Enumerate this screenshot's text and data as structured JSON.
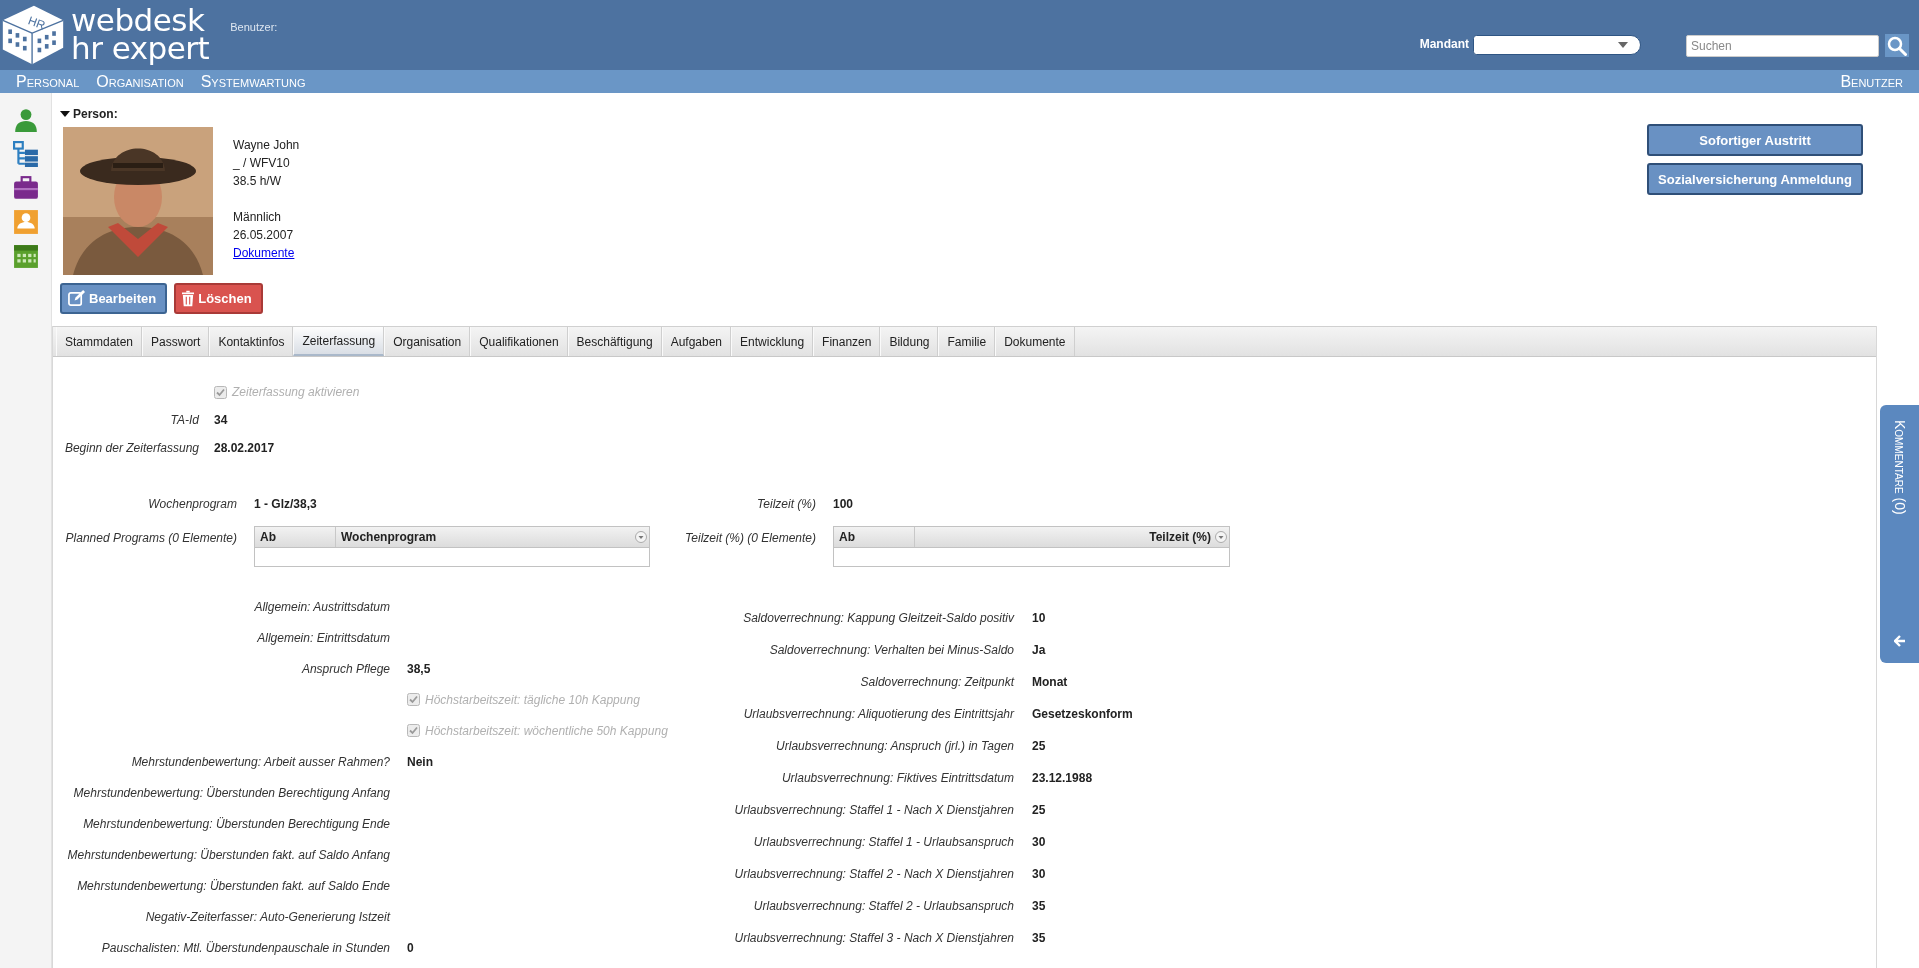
{
  "header": {
    "logo": {
      "badge": "HR",
      "line1": "webdesk",
      "line2": "hr expert"
    },
    "user_label": "Benutzer:",
    "mandant": {
      "label": "Mandant"
    },
    "search": {
      "placeholder": "Suchen"
    }
  },
  "nav": {
    "items": [
      "Personal",
      "Organisation",
      "Systemwartung"
    ],
    "right": "Benutzer"
  },
  "person": {
    "heading": "Person:",
    "expanded": true,
    "photo": {
      "kind": "picture"
    },
    "info": [
      [
        "Wayne John",
        "_ / WFV10",
        "38.5 h/W"
      ],
      [
        "Männlich",
        "26.05.2007"
      ]
    ],
    "link": "Dokumente",
    "actions": [
      {
        "label": "Bearbeiten",
        "kind": "edit"
      },
      {
        "label": "Löschen",
        "kind": "delete"
      }
    ],
    "side_actions": [
      "Sofortiger Austritt",
      "Sozialversicherung Anmeldung"
    ]
  },
  "tabs": [
    {
      "label": "Stammdaten",
      "selected": false
    },
    {
      "label": "Passwort",
      "selected": false
    },
    {
      "label": "Kontaktinfos",
      "selected": false
    },
    {
      "label": "Zeiterfassung",
      "selected": true
    },
    {
      "label": "Organisation",
      "selected": false
    },
    {
      "label": "Qualifikationen",
      "selected": false
    },
    {
      "label": "Beschäftigung",
      "selected": false
    },
    {
      "label": "Aufgaben",
      "selected": false
    },
    {
      "label": "Entwicklung",
      "selected": false
    },
    {
      "label": "Finanzen",
      "selected": false
    },
    {
      "label": "Bildung",
      "selected": false
    },
    {
      "label": "Familie",
      "selected": false
    },
    {
      "label": "Dokumente",
      "selected": false
    }
  ],
  "form": {
    "activate": {
      "label": "Zeiterfassung aktivieren",
      "checked": true,
      "disabled": true
    },
    "fields": [
      {
        "label": "TA-Id",
        "value": "34"
      },
      {
        "label": "Beginn der Zeiterfassung",
        "value": "28.02.2017"
      }
    ]
  },
  "programs": [
    {
      "label": "Wochenprogram",
      "value": "1 - Glz/38,3",
      "grid": {
        "label": "Planned Programs (0 Elemente)",
        "columns": [
          {
            "label": "Ab",
            "align_right": false
          },
          {
            "label": "Wochenprogram",
            "align_right": false
          }
        ]
      }
    },
    {
      "label": "Teilzeit (%)",
      "value": "100",
      "grid": {
        "label": "Teilzeit (%) (0 Elemente)",
        "columns": [
          {
            "label": "Ab",
            "align_right": false
          },
          {
            "label": "Teilzeit (%)",
            "align_right": true
          }
        ]
      }
    }
  ],
  "settings_left": [
    {
      "kind": "field",
      "label": "Allgemein: Austrittsdatum"
    },
    {
      "kind": "field",
      "label": "Allgemein: Eintrittsdatum"
    },
    {
      "kind": "field",
      "label": "Anspruch Pflege",
      "value": "38,5"
    },
    {
      "kind": "checkbox",
      "label": "Höchstarbeitszeit: tägliche 10h Kappung",
      "checked": true,
      "disabled": true
    },
    {
      "kind": "checkbox",
      "label": "Höchstarbeitszeit: wöchentliche 50h Kappung",
      "checked": true,
      "disabled": true
    },
    {
      "kind": "field",
      "label": "Mehrstundenbewertung: Arbeit ausser Rahmen?",
      "value": "Nein"
    },
    {
      "kind": "field",
      "label": "Mehrstundenbewertung: Überstunden Berechtigung Anfang"
    },
    {
      "kind": "field",
      "label": "Mehrstundenbewertung: Überstunden Berechtigung Ende"
    },
    {
      "kind": "field",
      "label": "Mehrstundenbewertung: Überstunden fakt. auf Saldo Anfang"
    },
    {
      "kind": "field",
      "label": "Mehrstundenbewertung: Überstunden fakt. auf Saldo Ende"
    },
    {
      "kind": "field",
      "label": "Negativ-Zeiterfasser: Auto-Generierung Istzeit"
    },
    {
      "kind": "field",
      "label": "Pauschalisten: Mtl. Überstundenpauschale in Stunden",
      "value": "0"
    }
  ],
  "settings_right": [
    {
      "kind": "field",
      "label": "Saldoverrechnung: Kappung Gleitzeit-Saldo positiv",
      "value": "10"
    },
    {
      "kind": "field",
      "label": "Saldoverrechnung: Verhalten bei Minus-Saldo",
      "value": "Ja"
    },
    {
      "kind": "field",
      "label": "Saldoverrechnung: Zeitpunkt",
      "value": "Monat"
    },
    {
      "kind": "field",
      "label": "Urlaubsverrechnung: Aliquotierung des Eintrittsjahr",
      "value": "Gesetzeskonform"
    },
    {
      "kind": "field",
      "label": "Urlaubsverrechnung: Anspruch (jrl.) in Tagen",
      "value": "25"
    },
    {
      "kind": "field",
      "label": "Urlaubsverrechnung: Fiktives Eintrittsdatum",
      "value": "23.12.1988"
    },
    {
      "kind": "field",
      "label": "Urlaubsverrechnung: Staffel 1 - Nach X Dienstjahren",
      "value": "25"
    },
    {
      "kind": "field",
      "label": "Urlaubsverrechnung: Staffel 1 - Urlaubsanspruch",
      "value": "30"
    },
    {
      "kind": "field",
      "label": "Urlaubsverrechnung: Staffel 2 - Nach X Dienstjahren",
      "value": "30"
    },
    {
      "kind": "field",
      "label": "Urlaubsverrechnung: Staffel 2 - Urlaubsanspruch",
      "value": "35"
    },
    {
      "kind": "field",
      "label": "Urlaubsverrechnung: Staffel 3 - Nach X Dienstjahren",
      "value": "35"
    }
  ],
  "comments": {
    "label": "Kommentare (0)"
  }
}
